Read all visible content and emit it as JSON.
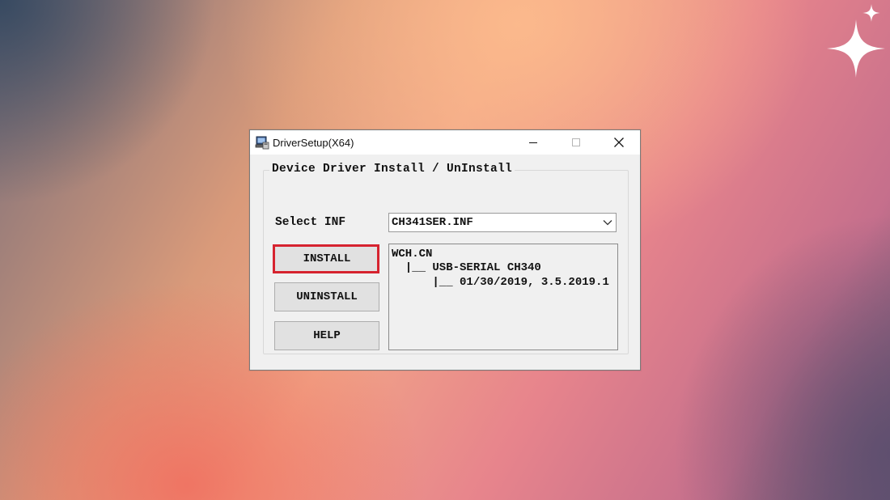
{
  "window": {
    "title": "DriverSetup(X64)"
  },
  "group": {
    "title": "Device Driver Install / UnInstall"
  },
  "select": {
    "label": "Select INF",
    "value": "CH341SER.INF"
  },
  "buttons": {
    "install": "INSTALL",
    "uninstall": "UNINSTALL",
    "help": "HELP"
  },
  "info": {
    "lines": [
      "WCH.CN",
      "  |__ USB-SERIAL CH340",
      "      |__ 01/30/2019, 3.5.2019.1"
    ]
  },
  "colors": {
    "highlight_border": "#d6232f",
    "window_bg": "#f0f0f0",
    "button_bg": "#e1e1e1"
  },
  "icons": {
    "app": "computer-setup-icon",
    "minimize": "minimize-icon",
    "maximize": "maximize-icon",
    "close": "close-icon",
    "dropdown": "chevron-down-icon",
    "decoration": "sparkle-icon"
  }
}
